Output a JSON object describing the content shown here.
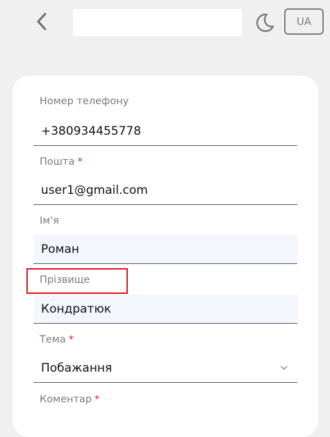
{
  "header": {
    "search_value": "",
    "lang_label": "UA"
  },
  "form": {
    "phone": {
      "label": "Номер телефону",
      "value": "+380934455778"
    },
    "email": {
      "label": "Пошта",
      "required_mark": "*",
      "value": "user1@gmail.com"
    },
    "first_name": {
      "label": "Ім'я",
      "value": "Роман"
    },
    "last_name": {
      "label": "Прізвище",
      "value": "Кондратюк"
    },
    "topic": {
      "label": "Тема",
      "required_mark": "*",
      "value": "Побажання"
    },
    "comment": {
      "label": "Коментар",
      "required_mark": "*"
    }
  },
  "colors": {
    "background": "#f0f0f0",
    "card": "#ffffff",
    "filled_field": "#f3f7fd",
    "required": "#e0192e",
    "highlight": "#e8101c"
  }
}
